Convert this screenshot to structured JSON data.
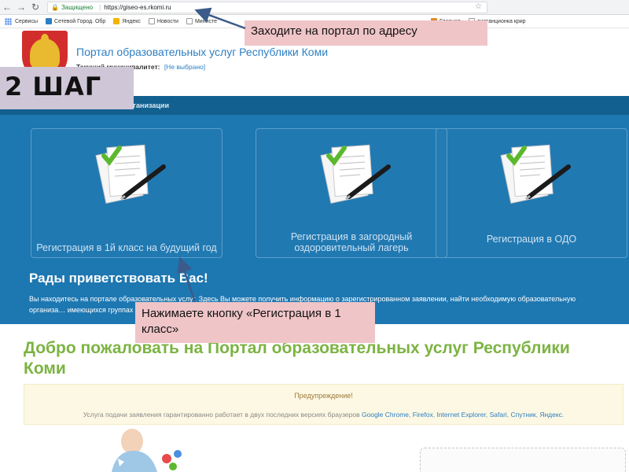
{
  "browser": {
    "secure_label": "Защищено",
    "url": "https://giseo-es.rkomi.ru"
  },
  "bookmarks": [
    {
      "label": "Сервисы",
      "color": "#4285f4"
    },
    {
      "label": "Сетевой Город. Обр",
      "color": "#2d7fc3"
    },
    {
      "label": "Яндекс",
      "color": "#f4b400"
    },
    {
      "label": "Новости",
      "color": "#9e9e9e"
    },
    {
      "label": "Министе",
      "color": "#9e9e9e"
    },
    {
      "label": "",
      "color": "#9e9e9e"
    },
    {
      "label": "Главная",
      "color": "#e08a2a"
    },
    {
      "label": "дистанционка крир",
      "color": "#9e9e9e"
    }
  ],
  "portal": {
    "title": "Портал образовательных услуг Республики Коми",
    "municipality_label": "Текущий муниципалитет:",
    "municipality_value": "[Не выбрано]",
    "nav_label": "ательные организации"
  },
  "cards": [
    {
      "label": "Регистрация в 1й класс на будущий год"
    },
    {
      "label": "Регистрация в загородный оздоровительный лагерь"
    },
    {
      "label": "Регистрация в ОДО"
    }
  ],
  "hero": {
    "greeting": "Рады приветствовать Вас!",
    "text": "Вы находитесь на портале образовательных услуг. Здесь Вы можете получить информацию о зарегистрированном заявлении, найти необходимую образовательную организа… имеющихся группах и наличии свободных мест в них."
  },
  "welcome": {
    "title": "Добро пожаловать на Портал образовательных услуг Республики Коми"
  },
  "warning": {
    "title": "Предупреждение!",
    "text_prefix": "Услуга подачи заявления гарантированно работает в двух последних версиях браузеров",
    "browsers": [
      "Google Chrome",
      "Firefox",
      "Internet Explorer",
      "Safari",
      "Спутник",
      "Яндекс"
    ]
  },
  "annotations": {
    "callout_url": "Заходите на портал по адресу",
    "step": "2 ШАГ",
    "callout_button": "Нажимаете кнопку «Регистрация в 1 класс»"
  },
  "colors": {
    "hero_blue": "#1d77b1",
    "welcome_green": "#7cb342",
    "link_blue": "#2d7fc3",
    "callout_pink": "#f0c5c8",
    "step_lavender": "#cfc7d8"
  }
}
